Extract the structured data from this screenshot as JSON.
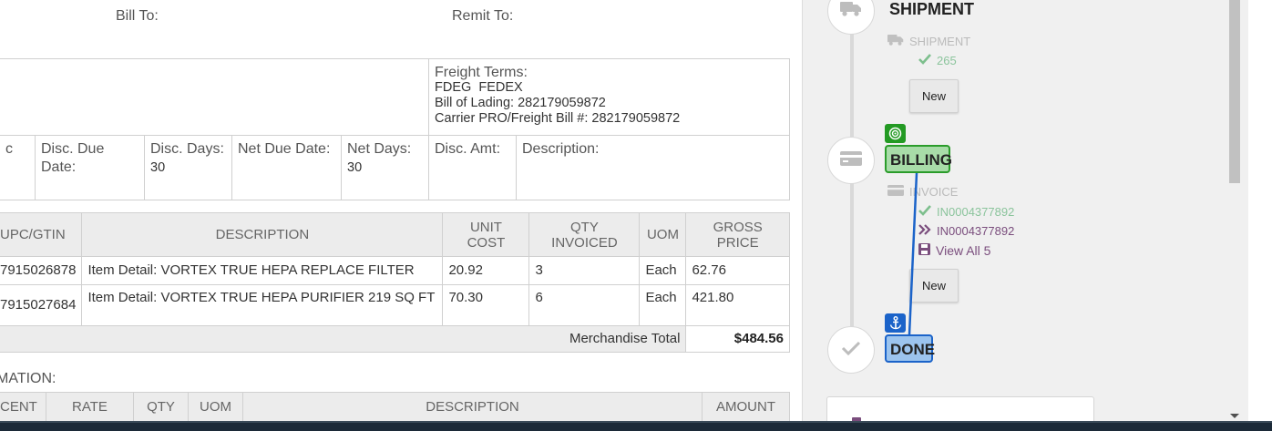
{
  "header": {
    "bill_to": "Bill To:",
    "remit_to": "Remit To:"
  },
  "freight": {
    "label": "Freight Terms:",
    "carrier": "FDEG  FEDEX",
    "bill_of_lading": "Bill of Lading: 282179059872",
    "carrier_pro": "Carrier PRO/Freight Bill #: 282179059872"
  },
  "terms": {
    "c0": "c",
    "disc_due_date": "Disc. Due Date:",
    "disc_days": "Disc. Days:",
    "disc_days_value": "30",
    "net_due_date": "Net Due Date:",
    "net_days": "Net Days:",
    "net_days_value": "30",
    "disc_amt": "Disc. Amt:",
    "description": "Description:"
  },
  "items": {
    "headers": {
      "upc": "UPC/GTIN",
      "description": "DESCRIPTION",
      "unit_cost_1": "UNIT",
      "unit_cost_2": "COST",
      "qty_1": "QTY",
      "qty_2": "INVOICED",
      "uom": "UOM",
      "gross_1": "GROSS",
      "gross_2": "PRICE"
    },
    "rows": [
      {
        "upc": "7915026878",
        "description": "Item Detail: VORTEX TRUE HEPA REPLACE FILTER",
        "unit_cost": "20.92",
        "qty": "3",
        "uom": "Each",
        "gross": "62.76"
      },
      {
        "upc": "7915027684",
        "description": "Item Detail: VORTEX TRUE HEPA PURIFIER 219 SQ FT",
        "unit_cost": "70.30",
        "qty": "6",
        "uom": "Each",
        "gross": "421.80"
      }
    ],
    "total_label": "Merchandise Total",
    "total_value": "$484.56"
  },
  "info_title": "MATION:",
  "charges": {
    "headers": {
      "percent": "CENT",
      "rate": "RATE",
      "qty": "QTY",
      "uom": "UOM",
      "description": "DESCRIPTION",
      "amount": "AMOUNT"
    }
  },
  "workflow": {
    "shipment": {
      "title": "SHIPMENT",
      "doc_type": "SHIPMENT",
      "doc_ok": "265",
      "new_label": "New"
    },
    "billing": {
      "title": "BILLING",
      "doc_type": "INVOICE",
      "doc_ok": "IN0004377892",
      "doc_link": "IN0004377892",
      "view_all": "View All 5",
      "new_label": "New"
    },
    "done": {
      "title": "DONE"
    }
  },
  "colors": {
    "billing_badge": "#a8dca8",
    "billing_border": "#2a9c2a",
    "done_badge": "#9cc4ee",
    "done_border": "#1b63c9",
    "connector": "#1b63c9",
    "ok_green": "#8bc49c",
    "link_purple": "#7a4d7d"
  },
  "icons": [
    "truck-icon",
    "credit-card-icon",
    "check-icon",
    "target-icon",
    "anchor-icon",
    "floppy-disk-icon",
    "double-chevron-right-icon"
  ]
}
